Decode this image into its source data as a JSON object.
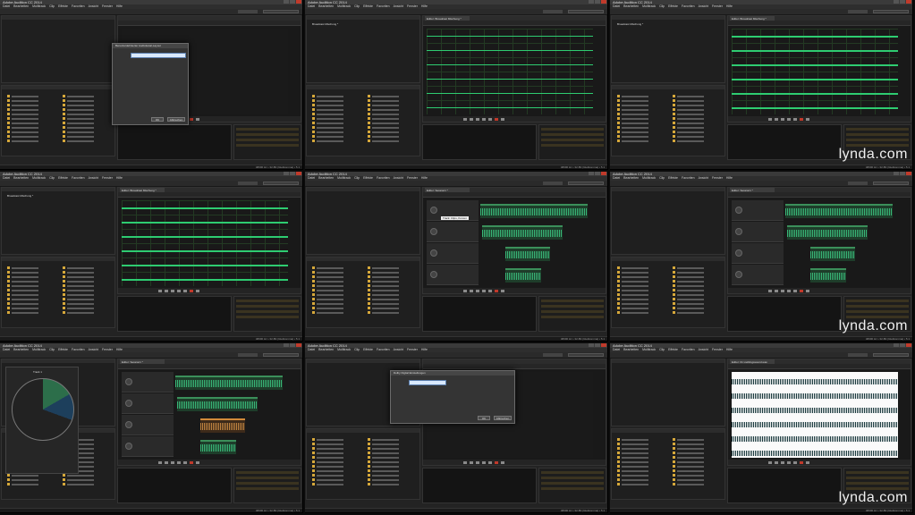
{
  "app": {
    "title": "Adobe Audition CC 2014",
    "watermark": "lynda.com"
  },
  "menu": [
    "Datei",
    "Bearbeiten",
    "Multitrack",
    "Clip",
    "Effekte",
    "Favoriten",
    "Ansicht",
    "Fenster",
    "Hilfe"
  ],
  "panels": [
    {
      "id": "p1",
      "editor_tab": "",
      "dialog": {
        "title": "Benutzerdefinierter Audiokanal-Layout",
        "ok": "OK",
        "cancel": "Abbrechen"
      }
    },
    {
      "id": "p2",
      "editor_tab": "Editor: Broadcast Mischung *",
      "left_item": "Broadcast Mischung *"
    },
    {
      "id": "p3",
      "editor_tab": "Editor: Broadcast Mischung *",
      "left_item": "Broadcast Mischung *"
    },
    {
      "id": "p4",
      "editor_tab": "Editor: Broadcast Mischung *",
      "left_item": "Broadcast Mischung *"
    },
    {
      "id": "p5",
      "editor_tab": "Editor: Session1 *",
      "tooltip": "Track: Clips, Kurven"
    },
    {
      "id": "p6",
      "editor_tab": "Editor: Session1 *"
    },
    {
      "id": "p7",
      "editor_tab": "Editor: Session1 *",
      "surround": "Track 1"
    },
    {
      "id": "p8",
      "editor_tab": "",
      "dialog": {
        "title": "Dolby Digital Einstellungen",
        "ok": "OK",
        "cancel": "Abbrechen"
      }
    },
    {
      "id": "p9",
      "editor_tab": "Editor: 01 Lieblingssound.wav"
    }
  ],
  "status": "48000 Hz • 32-Bit (Gleitkomma) • 5.1",
  "colors": {
    "accent": "#2ecc71",
    "panel": "#232323",
    "title": "#3a3a3a"
  }
}
